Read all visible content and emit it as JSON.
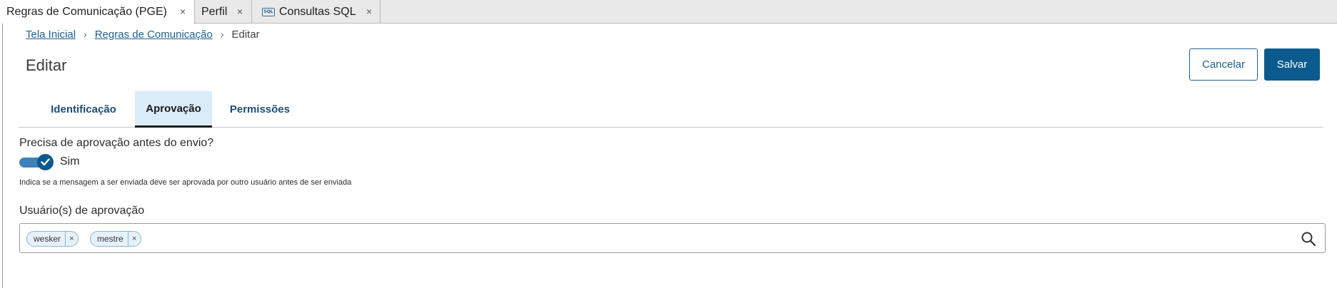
{
  "window_tabs": [
    {
      "label": "Regras de Comunicação (PGE)",
      "close": "×"
    },
    {
      "label": "Perfil",
      "close": "×"
    },
    {
      "label": "Consultas SQL",
      "icon_text": "SQL",
      "close": "×"
    }
  ],
  "breadcrumb": {
    "items": [
      "Tela Inicial",
      "Regras de Comunicação"
    ],
    "current": "Editar",
    "separator": "›"
  },
  "page": {
    "title": "Editar",
    "cancel_label": "Cancelar",
    "save_label": "Salvar"
  },
  "tabs": [
    {
      "label": "Identificação",
      "active": false
    },
    {
      "label": "Aprovação",
      "active": true
    },
    {
      "label": "Permissões",
      "active": false
    }
  ],
  "approval": {
    "question": "Precisa de aprovação antes do envio?",
    "toggle_value": "Sim",
    "toggle_on": true,
    "help_text": "Indica se a mensagem a ser enviada deve ser aprovada por outro usuário antes de ser enviada",
    "users_label": "Usuário(s) de aprovação",
    "users": [
      {
        "name": "wesker",
        "remove": "×"
      },
      {
        "name": "mestre",
        "remove": "×"
      }
    ]
  },
  "colors": {
    "primary": "#0b5a8d",
    "link": "#1f5f8f",
    "active_tab_bg": "#d9ecf7",
    "chip_bg": "#e6f1fa"
  },
  "icons": {
    "search": "search-icon",
    "toggle_check": "check-icon"
  }
}
